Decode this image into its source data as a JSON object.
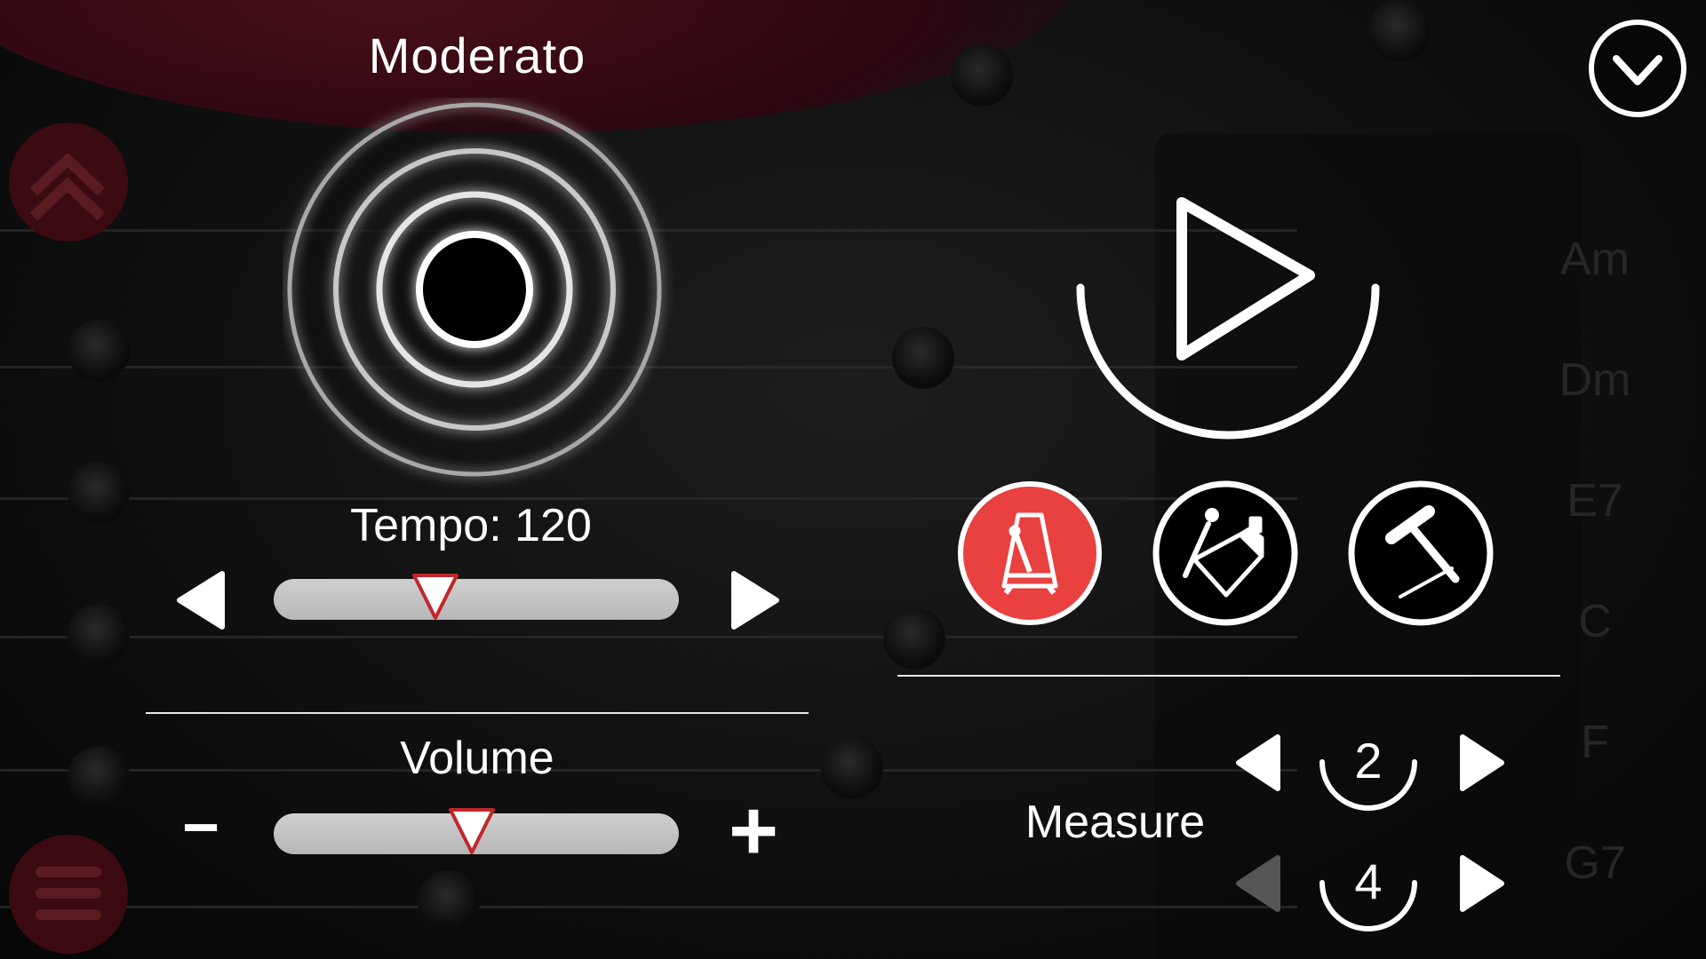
{
  "tempo_marking": "Moderato",
  "tempo": {
    "label": "Tempo:",
    "value": "120",
    "slider_level_percent": 40
  },
  "volume": {
    "label": "Volume",
    "minus_glyph": "−",
    "plus_glyph": "+",
    "slider_level_percent": 49
  },
  "measure": {
    "label": "Measure",
    "beats": "2",
    "note_value": "4"
  },
  "chords": [
    "Am",
    "Dm",
    "E7",
    "C",
    "F",
    "G7"
  ],
  "icons": {
    "pulse": "concentric-rings-icon",
    "play": "play-icon",
    "collapse": "chevron-down-icon",
    "metronome": "metronome-icon",
    "cowbell": "cowbell-icon",
    "woodblock": "woodblock-icon",
    "scroll_up": "double-chevron-up-icon",
    "menu": "hamburger-menu-icon"
  },
  "colors": {
    "accent": "#e8413f",
    "foreground": "#ffffff",
    "slider": "#c4c4c4",
    "background": "#0c0c0c"
  }
}
